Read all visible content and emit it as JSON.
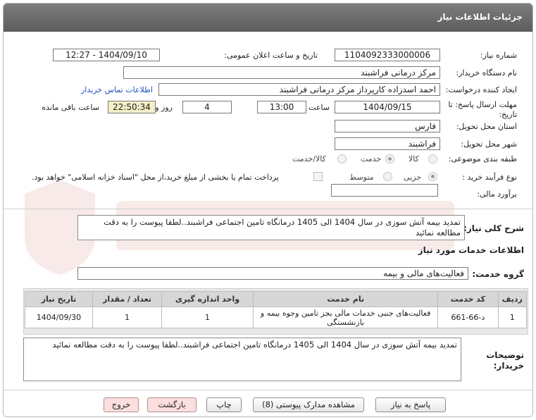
{
  "header": {
    "title": "جزئیات اطلاعات نیاز"
  },
  "fields": {
    "need_number_label": "شماره نیاز:",
    "need_number": "1104092333000006",
    "announce_label": "تاریخ و ساعت اعلان عمومی:",
    "announce_value": "1404/09/10 - 12:27",
    "buyer_org_label": "نام دستگاه خریدار:",
    "buyer_org": "مرکز درمانی فراشبند",
    "creator_label": "ایجاد کننده درخواست:",
    "creator": "احمد اسدزاده کارپرداز مرکز درمانی فراشبند",
    "contact_link": "اطلاعات تماس خریدار",
    "deadline_label_1": "مهلت ارسال پاسخ: تا",
    "deadline_label_2": "تاریخ:",
    "deadline_date": "1404/09/15",
    "time_label": "ساعت",
    "deadline_time": "13:00",
    "days_value": "4",
    "days_label": "روز و",
    "remaining_time": "22:50:34",
    "remaining_label": "ساعت باقی مانده",
    "province_label": "استان محل تحویل:",
    "province": "فارس",
    "city_label": "شهر محل تحویل:",
    "city": "فراشبند",
    "category_label": "طبقه بندی موضوعی:",
    "category_options": [
      "کالا",
      "خدمت",
      "کالا/خدمت"
    ],
    "category_selected": "خدمت",
    "process_label": "نوع فرآیند خرید :",
    "process_options": [
      "جزیی",
      "متوسط"
    ],
    "process_note": "پرداخت تمام یا بخشی از مبلغ خرید،از محل \"اسناد خزانه اسلامی\" خواهد بود.",
    "budget_label": "برآورد مالی:",
    "budget_value": ""
  },
  "summary": {
    "label": "شرح کلی نیاز:",
    "text": "تمدید بیمه آتش سوزی در سال 1404 الی 1405 درمانگاه تامین اجتماعی فراشبند..لطفا پیوست را به دقت مطالعه نمائید"
  },
  "services": {
    "section_title": "اطلاعات خدمات مورد نیاز",
    "group_label": "گروه خدمت:",
    "group_value": "فعالیت‌های مالی و بیمه",
    "columns": [
      "ردیف",
      "کد خدمت",
      "نام خدمت",
      "واحد اندازه گیری",
      "تعداد / مقدار",
      "تاریخ نیاز"
    ],
    "rows": [
      [
        "1",
        "د-66-661",
        "فعالیت‌های جنبی خدمات مالی بجز تامین وجوه بیمه و بازنشستگی",
        "1",
        "1",
        "1404/09/30"
      ]
    ]
  },
  "buyer_notes": {
    "label_1": "توضیحات",
    "label_2": "خریدار:",
    "text": "تمدید بیمه آتش سوزی در سال 1404 الی 1405 درمانگاه تامین اجتماعی فراشبند..لطفا پیوست را به دقت مطالعه نمائید"
  },
  "buttons": {
    "reply": "پاسخ به نیاز",
    "attachments": "مشاهده مدارک پیوستی (8)",
    "print": "چاپ",
    "back": "بازگشت",
    "exit": "خروج"
  },
  "colors": {
    "titlebar": "#6b6b6b",
    "link": "#1f4fbf",
    "remaining_bg": "#f3efc6",
    "exit_bg": "#fbdede"
  }
}
